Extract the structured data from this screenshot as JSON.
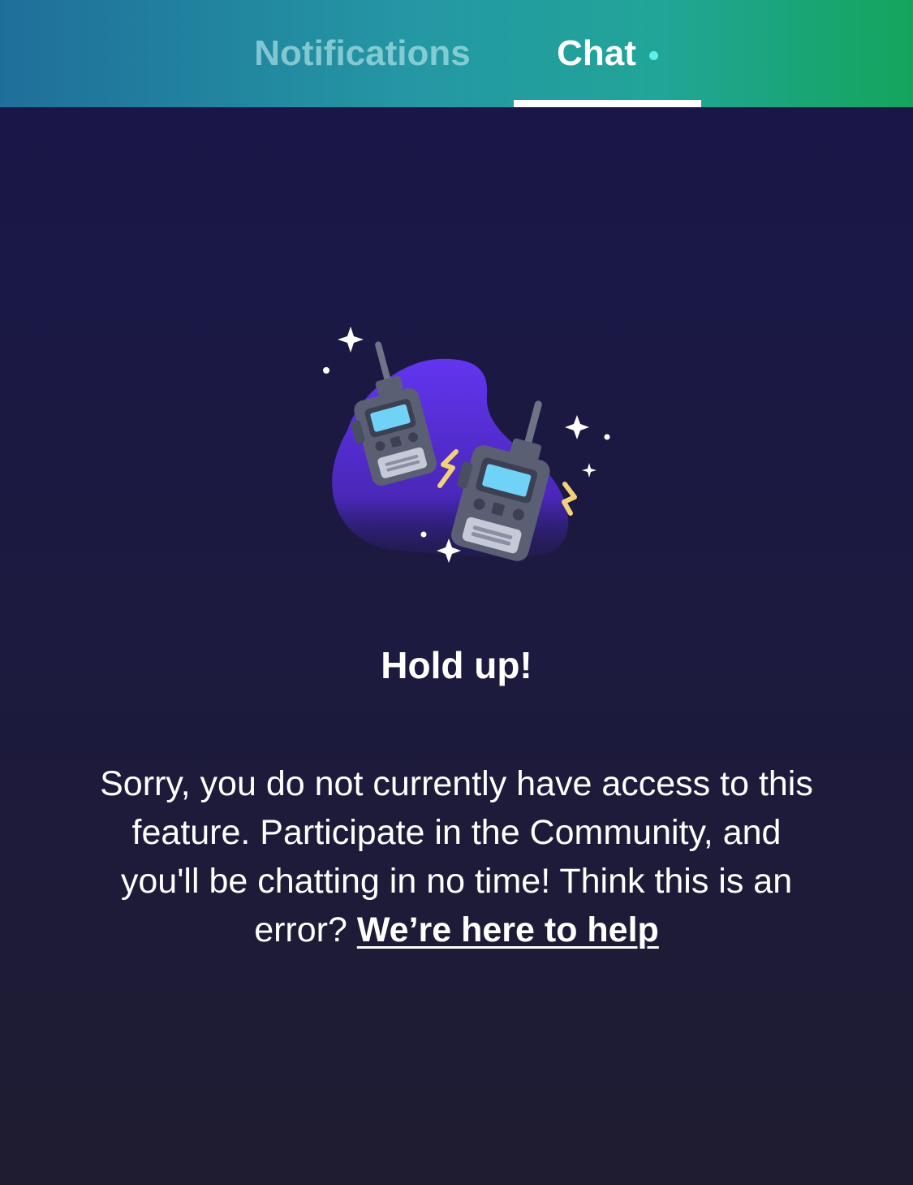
{
  "header": {
    "tabs": [
      {
        "label": "Notifications",
        "active": false
      },
      {
        "label": "Chat",
        "active": true,
        "has_unread_dot": true
      }
    ]
  },
  "illustration": {
    "icon": "walkie-talkies-icon",
    "blob_color": "#6235f0",
    "screen_color": "#6fd2f6",
    "spark_color": "#f1d27a"
  },
  "empty_state": {
    "title": "Hold up!",
    "message": "Sorry, you do not currently have access to this feature. Participate in the Community, and you'll be chatting in no time! Think this is an error?",
    "help_link": "We’re here to help"
  },
  "colors": {
    "header_gradient_start": "#1f6f9a",
    "header_gradient_end": "#14a55c",
    "background": "#1b1944",
    "unread_dot": "#5ff0ea"
  }
}
